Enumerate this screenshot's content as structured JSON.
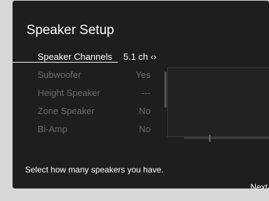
{
  "screen": {
    "title": "Speaker Setup",
    "items": [
      {
        "label": "Speaker Channels",
        "value": "5.1 ch ‹›"
      },
      {
        "label": "Subwoofer",
        "value": "Yes"
      },
      {
        "label": "Height Speaker",
        "value": "---"
      },
      {
        "label": "Zone Speaker",
        "value": "No"
      },
      {
        "label": "Bi-Amp",
        "value": "No"
      }
    ],
    "help_text": "Select how many speakers you have.",
    "next_label": "Next"
  }
}
